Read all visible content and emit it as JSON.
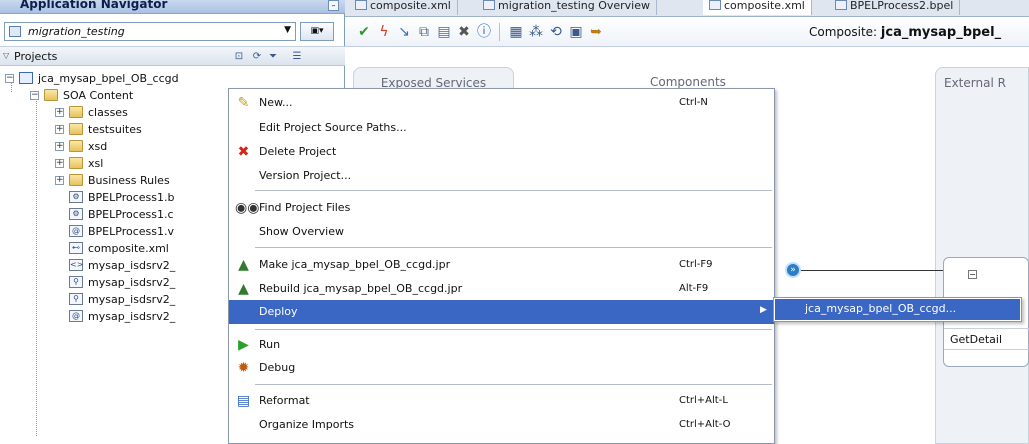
{
  "navigator": {
    "title": "Application Navigator",
    "app_name": "migration_testing",
    "projects_label": "Projects",
    "tree": [
      {
        "label": "jca_mysap_bpel_OB_ccgd",
        "kind": "project",
        "level": 0
      },
      {
        "label": "SOA Content",
        "kind": "folder",
        "level": 1
      },
      {
        "label": "classes",
        "kind": "folder",
        "level": 2
      },
      {
        "label": "testsuites",
        "kind": "folder",
        "level": 2
      },
      {
        "label": "xsd",
        "kind": "folder",
        "level": 2
      },
      {
        "label": "xsl",
        "kind": "folder",
        "level": 2
      },
      {
        "label": "Business Rules",
        "kind": "folder",
        "level": 2
      },
      {
        "label": "BPELProcess1.b",
        "kind": "file",
        "level": 2
      },
      {
        "label": "BPELProcess1.c",
        "kind": "file",
        "level": 2
      },
      {
        "label": "BPELProcess1.v",
        "kind": "file",
        "level": 2
      },
      {
        "label": "composite.xml",
        "kind": "file",
        "level": 2
      },
      {
        "label": "mysap_isdsrv2_",
        "kind": "file",
        "level": 2
      },
      {
        "label": "mysap_isdsrv2_",
        "kind": "file",
        "level": 2
      },
      {
        "label": "mysap_isdsrv2_",
        "kind": "file",
        "level": 2
      },
      {
        "label": "mysap_isdsrv2_",
        "kind": "file",
        "level": 2
      }
    ]
  },
  "editor": {
    "tabs": [
      "composite.xml",
      "migration_testing Overview",
      "composite.xml",
      "BPELProcess2.bpel"
    ],
    "composite_prefix": "Composite:",
    "composite_name": "jca_mysap_bpel_",
    "columns": {
      "services": "Exposed Services",
      "components": "Components",
      "external": "External R"
    },
    "reference_operation": "GetDetail"
  },
  "context_menu": {
    "items": [
      {
        "label": "New...",
        "shortcut": "Ctrl-N",
        "icon": "new-icon"
      },
      {
        "label": "Edit Project Source Paths...",
        "shortcut": "",
        "icon": ""
      },
      {
        "label": "Delete Project",
        "shortcut": "",
        "icon": "delete-icon"
      },
      {
        "label": "Version Project...",
        "shortcut": "",
        "icon": ""
      },
      {
        "label": "Find Project Files",
        "shortcut": "",
        "icon": "binoculars-icon"
      },
      {
        "label": "Show Overview",
        "shortcut": "",
        "icon": ""
      },
      {
        "label": "Make jca_mysap_bpel_OB_ccgd.jpr",
        "shortcut": "Ctrl-F9",
        "icon": "make-icon"
      },
      {
        "label": "Rebuild jca_mysap_bpel_OB_ccgd.jpr",
        "shortcut": "Alt-F9",
        "icon": "rebuild-icon"
      },
      {
        "label": "Deploy",
        "shortcut": "",
        "icon": ""
      },
      {
        "label": "Run",
        "shortcut": "",
        "icon": "run-icon"
      },
      {
        "label": "Debug",
        "shortcut": "",
        "icon": "debug-icon"
      },
      {
        "label": "Reformat",
        "shortcut": "Ctrl+Alt-L",
        "icon": "reformat-icon"
      },
      {
        "label": "Organize Imports",
        "shortcut": "Ctrl+Alt-O",
        "icon": ""
      }
    ],
    "deploy_submenu": [
      "jca_mysap_bpel_OB_ccgd..."
    ]
  },
  "colors": {
    "highlight": "#3a66c4",
    "accent": "#1d4fb4"
  }
}
